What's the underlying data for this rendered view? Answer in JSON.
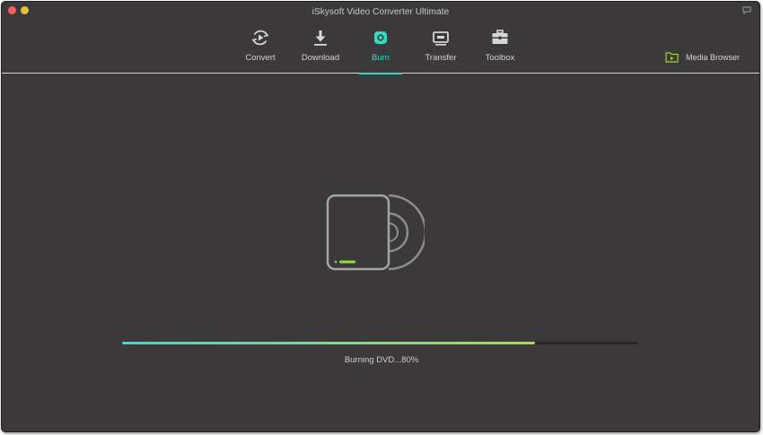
{
  "window": {
    "title": "iSkysoft Video Converter Ultimate"
  },
  "toolbar": {
    "tabs": [
      {
        "label": "Convert",
        "icon": "convert-icon"
      },
      {
        "label": "Download",
        "icon": "download-icon"
      },
      {
        "label": "Burn",
        "icon": "burn-icon",
        "active": true
      },
      {
        "label": "Transfer",
        "icon": "transfer-icon"
      },
      {
        "label": "Toolbox",
        "icon": "toolbox-icon"
      }
    ],
    "media_browser_label": "Media Browser"
  },
  "burn": {
    "progress_percent": 80,
    "status_text": "Burning DVD...80%"
  },
  "colors": {
    "accent": "#35d6c6",
    "progress_start": "#37dcc8",
    "progress_end": "#a8e03a",
    "background": "#3b3939",
    "media_browser_icon": "#9bd63a"
  }
}
